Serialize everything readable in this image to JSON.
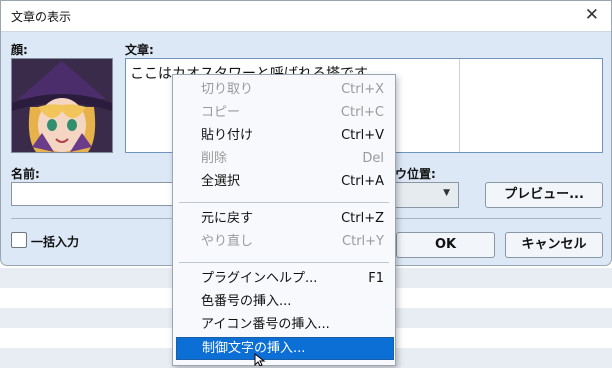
{
  "window": {
    "title": "文章の表示",
    "close_glyph": "✕"
  },
  "labels": {
    "face": "顔:",
    "text": "文章:",
    "name": "名前:",
    "window_position_fragment": "ウ位置:",
    "batch_input": "一括入力"
  },
  "text_area": {
    "content": "ここはカオスタワーと呼ばれる塔です"
  },
  "name_field": {
    "value": ""
  },
  "select": {
    "value": ""
  },
  "buttons": {
    "preview": "プレビュー...",
    "ok": "OK",
    "cancel": "キャンセル"
  },
  "context_menu": {
    "items": [
      {
        "label": "切り取り",
        "shortcut": "Ctrl+X",
        "enabled": false
      },
      {
        "label": "コピー",
        "shortcut": "Ctrl+C",
        "enabled": false
      },
      {
        "label": "貼り付け",
        "shortcut": "Ctrl+V",
        "enabled": true
      },
      {
        "label": "削除",
        "shortcut": "Del",
        "enabled": false
      },
      {
        "label": "全選択",
        "shortcut": "Ctrl+A",
        "enabled": true
      },
      {
        "label": "元に戻す",
        "shortcut": "Ctrl+Z",
        "enabled": true
      },
      {
        "label": "やり直し",
        "shortcut": "Ctrl+Y",
        "enabled": false
      },
      {
        "label": "プラグインヘルプ...",
        "shortcut": "F1",
        "enabled": true
      },
      {
        "label": "色番号の挿入...",
        "shortcut": "",
        "enabled": true
      },
      {
        "label": "アイコン番号の挿入...",
        "shortcut": "",
        "enabled": true
      },
      {
        "label": "制御文字の挿入...",
        "shortcut": "",
        "enabled": true,
        "highlighted": true
      }
    ]
  },
  "colors": {
    "dialog_bg": "#dce8f6",
    "menu_highlight": "#0b6fd6",
    "disabled_text": "#9a9a9a"
  },
  "icons": {
    "close": "close-icon",
    "dropdown": "chevron-down-icon",
    "cursor": "mouse-pointer-icon"
  }
}
